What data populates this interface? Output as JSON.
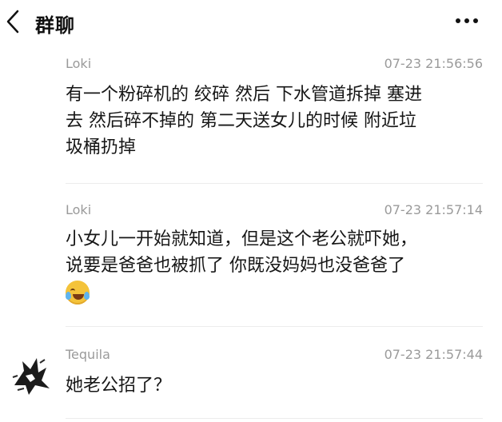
{
  "header": {
    "title": "群聊",
    "back_icon": "chevron-left-icon",
    "more_icon": "more-dots-icon"
  },
  "messages": [
    {
      "sender": "Loki",
      "time": "07-23 21:56:56",
      "lines": [
        "有一个粉碎机的 绞碎 然后 下水管道拆掉 塞进",
        "去 然后碎不掉的 第二天送女儿的时候 附近垃",
        "圾桶扔掉"
      ]
    },
    {
      "sender": "Loki",
      "time": "07-23 21:57:14",
      "lines": [
        "小女儿一开始就知道，但是这个老公就吓她，",
        "说要是爸爸也被抓了 你既没妈妈也没爸爸了"
      ],
      "emoji": "crying-laughing-emoji"
    },
    {
      "sender": "Tequila",
      "time": "07-23 21:57:44",
      "lines": [
        "她老公招了？"
      ],
      "avatar": "sketch-avatar"
    }
  ]
}
